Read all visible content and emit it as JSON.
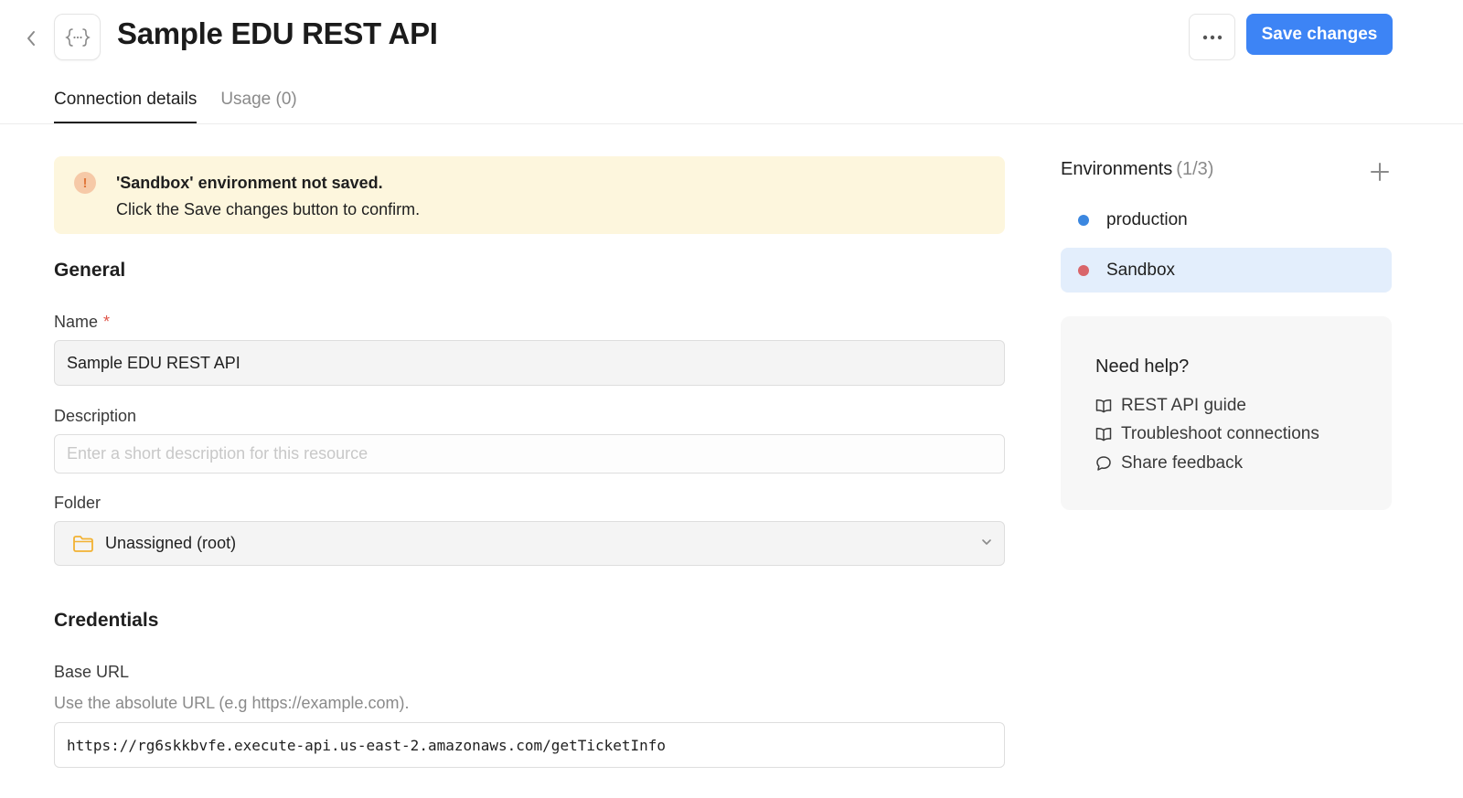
{
  "header": {
    "title": "Sample EDU REST API",
    "save_label": "Save changes",
    "more_label": "More options"
  },
  "tabs": [
    {
      "label": "Connection details",
      "active": true
    },
    {
      "label": "Usage",
      "count": "(0)",
      "active": false
    }
  ],
  "alert": {
    "title": "'Sandbox' environment not saved.",
    "body": "Click the Save changes button to confirm.",
    "icon_glyph": "!"
  },
  "general": {
    "section_title": "General",
    "name_label": "Name",
    "required_mark": "*",
    "name_value": "Sample EDU REST API",
    "description_label": "Description",
    "description_placeholder": "Enter a short description for this resource",
    "folder_label": "Folder",
    "folder_value": "Unassigned (root)"
  },
  "credentials": {
    "section_title": "Credentials",
    "base_url_label": "Base URL",
    "base_url_help": "Use the absolute URL (e.g https://example.com).",
    "base_url_value": "https://rg6skkbvfe.execute-api.us-east-2.amazonaws.com/getTicketInfo"
  },
  "environments": {
    "title": "Environments",
    "count": "(1/3)",
    "items": [
      {
        "name": "production",
        "color": "#3b87e0",
        "selected": false
      },
      {
        "name": "Sandbox",
        "color": "#d9656a",
        "selected": true
      }
    ]
  },
  "help": {
    "title": "Need help?",
    "links": [
      {
        "label": "REST API guide",
        "icon": "book-open-icon"
      },
      {
        "label": "Troubleshoot connections",
        "icon": "book-open-icon"
      },
      {
        "label": "Share feedback",
        "icon": "chat-bubble-icon"
      }
    ]
  },
  "colors": {
    "accent": "#3d84f5",
    "alert_bg": "#fdf6dd",
    "selected_env_bg": "#e3eefc",
    "folder_icon": "#f2b233"
  }
}
